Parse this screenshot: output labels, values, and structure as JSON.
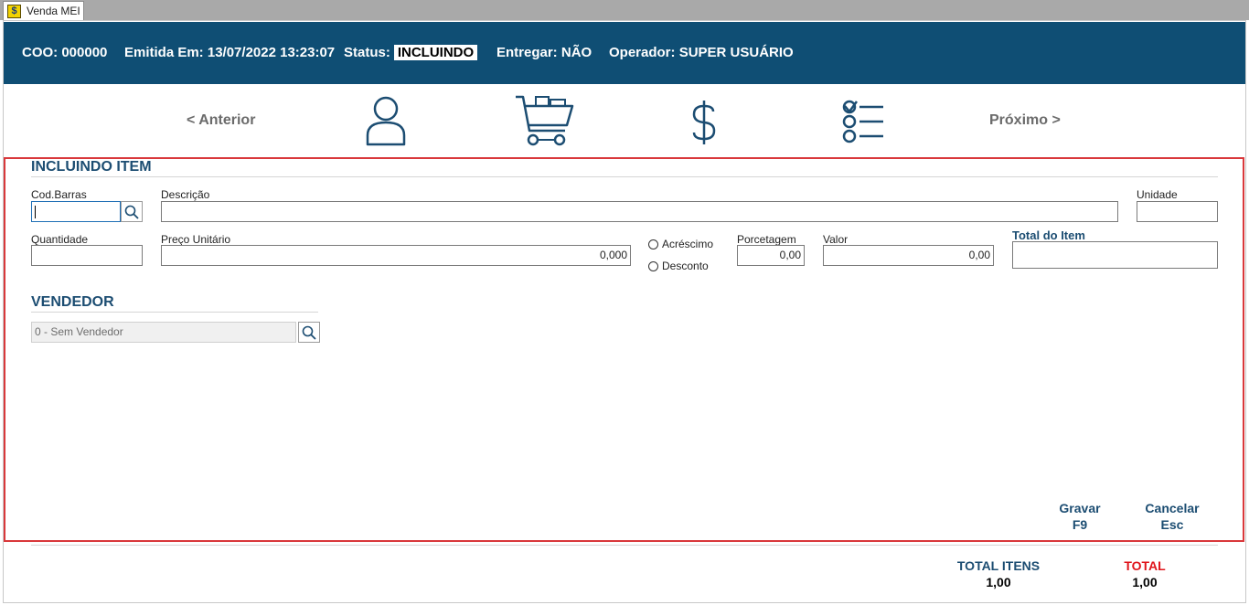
{
  "window": {
    "tab_title": "Venda MEI",
    "app_icon": "dollar-app-icon"
  },
  "header": {
    "coo_label": "COO:",
    "coo_value": "000000",
    "emitida_label": "Emitida Em:",
    "emitida_value": "13/07/2022 13:23:07",
    "status_label": "Status:",
    "status_value": "INCLUINDO",
    "entregar_label": "Entregar:",
    "entregar_value": "NÃO",
    "operador_label": "Operador:",
    "operador_value": "SUPER USUÁRIO",
    "background_color": "#0f4e74"
  },
  "wizard": {
    "prev_label": "< Anterior",
    "next_label": "Próximo >",
    "steps": [
      "person-icon",
      "shopping-cart-icon",
      "dollar-icon",
      "checklist-icon"
    ],
    "icon_color": "#1c4d72"
  },
  "item_section": {
    "title": "INCLUINDO ITEM",
    "cod_barras_label": "Cod.Barras",
    "cod_barras_value": "",
    "descricao_label": "Descrição",
    "descricao_value": "",
    "unidade_label": "Unidade",
    "unidade_value": "",
    "quantidade_label": "Quantidade",
    "quantidade_value": "",
    "preco_label": "Preço Unitário",
    "preco_value": "0,000",
    "acrescimo_label": "Acréscimo",
    "desconto_label": "Desconto",
    "porcentagem_label": "Porcetagem",
    "porcentagem_value": "0,00",
    "valor_label": "Valor",
    "valor_value": "0,00",
    "total_item_label": "Total do Item",
    "total_item_value": ""
  },
  "vendedor_section": {
    "title": "VENDEDOR",
    "selected_value": "0 - Sem Vendedor"
  },
  "actions": {
    "gravar_label": "Gravar",
    "gravar_key": "F9",
    "cancelar_label": "Cancelar",
    "cancelar_key": "Esc"
  },
  "footer": {
    "total_itens_label": "TOTAL ITENS",
    "total_itens_value": "1,00",
    "total_label": "TOTAL",
    "total_value": "1,00",
    "total_label_color": "#e0141b"
  },
  "colors": {
    "accent": "#1c4d72",
    "panel_border": "#d9383b"
  }
}
